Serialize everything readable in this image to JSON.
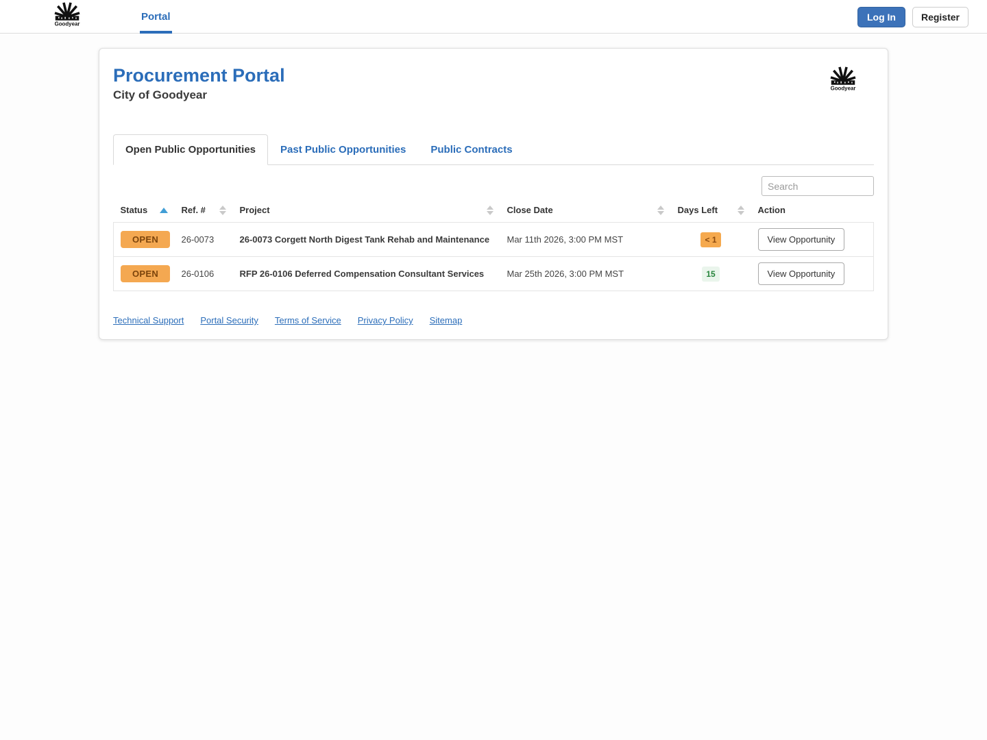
{
  "navbar": {
    "brand": "Goodyear",
    "nav_items": [
      {
        "label": "Portal",
        "active": true
      }
    ],
    "login_label": "Log In",
    "register_label": "Register"
  },
  "page": {
    "title": "Procurement Portal",
    "subtitle": "City of Goodyear"
  },
  "tabs": [
    {
      "label": "Open Public Opportunities",
      "active": true
    },
    {
      "label": "Past Public Opportunities",
      "active": false
    },
    {
      "label": "Public Contracts",
      "active": false
    }
  ],
  "search": {
    "placeholder": "Search"
  },
  "table": {
    "headers": [
      {
        "label": "Status",
        "sort": "asc"
      },
      {
        "label": "Ref. #",
        "sort": "both"
      },
      {
        "label": "Project",
        "sort": "both"
      },
      {
        "label": "Close Date",
        "sort": "both"
      },
      {
        "label": "Days Left",
        "sort": "both"
      },
      {
        "label": "Action",
        "sort": "none"
      }
    ],
    "rows": [
      {
        "status": "OPEN",
        "ref": "26-0073",
        "project": "26-0073 Corgett North Digest Tank Rehab and Maintenance",
        "close_date": "Mar 11th 2026, 3:00 PM MST",
        "days_left": "< 1",
        "days_left_variant": "warning",
        "action": "View Opportunity"
      },
      {
        "status": "OPEN",
        "ref": "26-0106",
        "project": "RFP 26-0106 Deferred Compensation Consultant Services",
        "close_date": "Mar 25th 2026, 3:00 PM MST",
        "days_left": "15",
        "days_left_variant": "success",
        "action": "View Opportunity"
      }
    ]
  },
  "footer_links": [
    "Technical Support",
    "Portal Security",
    "Terms of Service",
    "Privacy Policy",
    "Sitemap"
  ],
  "colors": {
    "accent_blue": "#2B6DB9",
    "open_badge_bg": "#F4A851",
    "open_badge_text": "#7C440C",
    "warning_badge_bg": "#F5A94E",
    "warning_badge_text": "#8A4A0F",
    "success_badge_bg": "#EAF5EC",
    "success_badge_text": "#27843C"
  }
}
